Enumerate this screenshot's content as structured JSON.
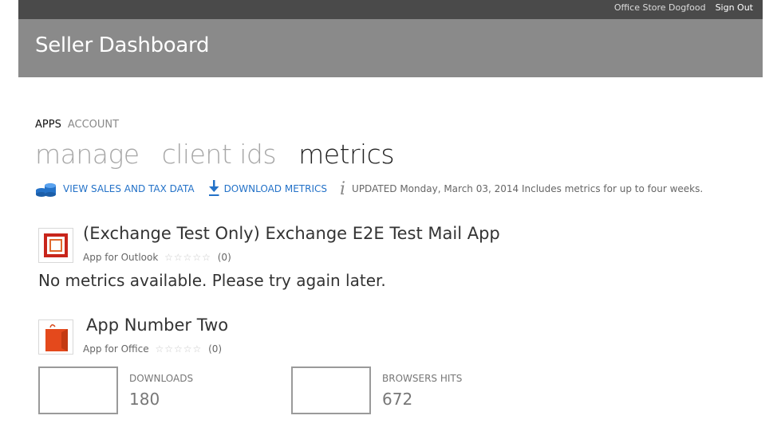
{
  "topbar": {
    "store_link": "Office Store Dogfood",
    "signout": "Sign Out"
  },
  "header": {
    "title": "Seller Dashboard"
  },
  "nav": {
    "apps": "APPS",
    "account": "ACCOUNT"
  },
  "pivots": {
    "manage": "manage",
    "client_ids": "client ids",
    "metrics": "metrics"
  },
  "actions": {
    "view_sales": "VIEW SALES AND TAX DATA",
    "download_metrics": "DOWNLOAD METRICS",
    "updated": "UPDATED Monday, March 03, 2014 Includes metrics for up to four weeks."
  },
  "apps": [
    {
      "title": "(Exchange Test Only) Exchange E2E Test Mail App",
      "type": "App for Outlook",
      "rating_count": "(0)",
      "message": "No metrics available. Please try again later."
    },
    {
      "title": "App Number Two",
      "type": "App for Office",
      "rating_count": "(0)",
      "metrics": [
        {
          "label": "DOWNLOADS",
          "value": "180"
        },
        {
          "label": "BROWSERS HITS",
          "value": "672"
        }
      ]
    }
  ],
  "icons": {
    "view_sales": "coins-stack-icon",
    "download": "download-arrow-icon",
    "info": "info-icon"
  },
  "colors": {
    "accent": "#2472c8",
    "header_bg": "#8a8a8a",
    "topbar_bg": "#4a4a4a"
  }
}
